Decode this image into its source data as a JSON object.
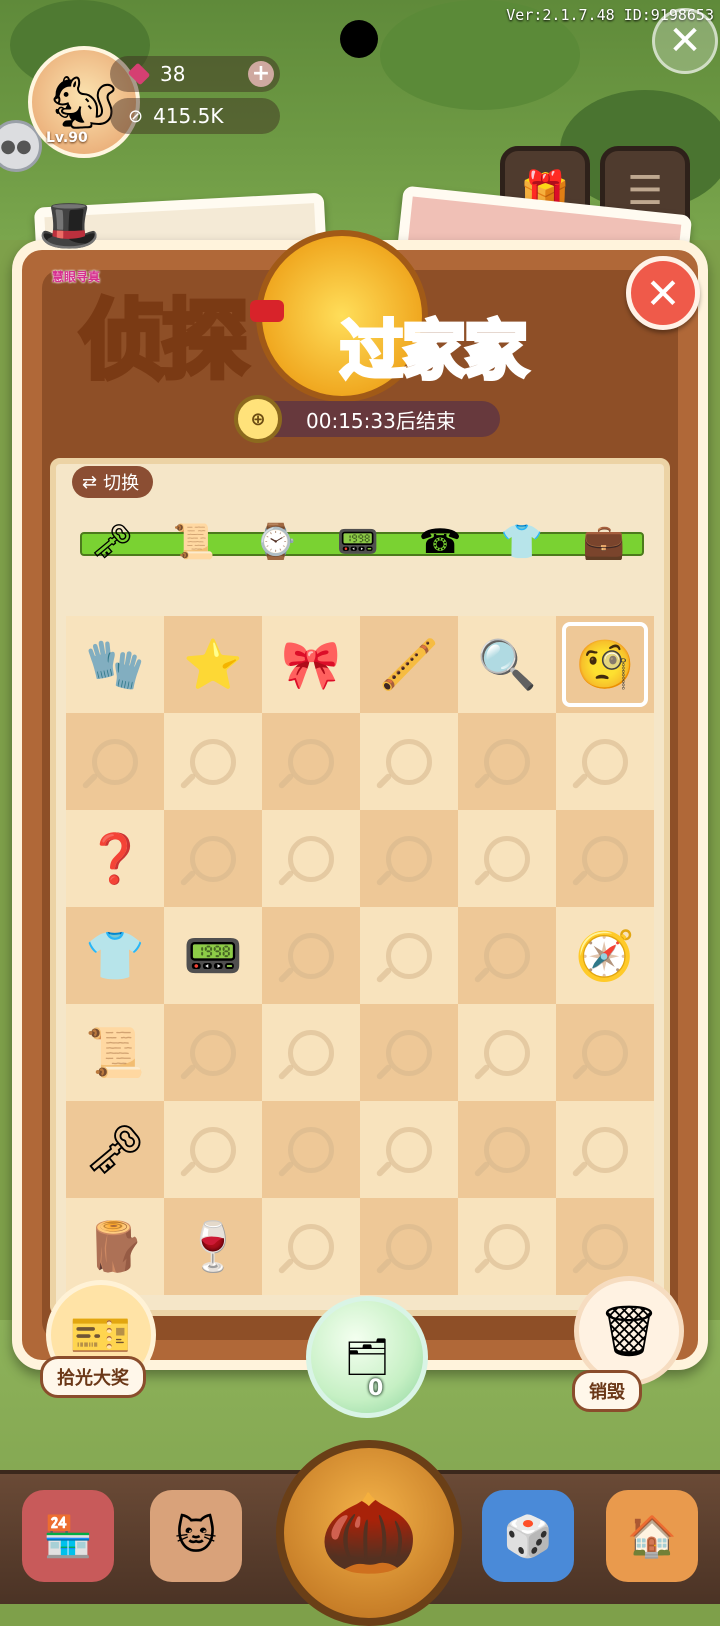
{
  "hud": {
    "version": "Ver:2.1.7.48 ID:9198653",
    "level": "Lv.90",
    "gems": "38",
    "seeds": "415.5K"
  },
  "event": {
    "badge_label": "慧眼寻真",
    "title_main": "侦探",
    "title_sub": "过家家",
    "timer": "00:15:33后结束",
    "switch_label": "切换"
  },
  "merge_chain": [
    {
      "icon": "key-icon"
    },
    {
      "icon": "torn-paper-icon"
    },
    {
      "icon": "pocket-watch-icon"
    },
    {
      "icon": "phone-device-icon"
    },
    {
      "icon": "telephone-icon"
    },
    {
      "icon": "shirt-icon"
    },
    {
      "icon": "briefcase-icon"
    }
  ],
  "grid": [
    [
      "gloves-icon",
      "badge-star-icon",
      "bowtie-icon",
      "pipe-icon",
      "magnifier-item-icon",
      "monocle-icon"
    ],
    [
      "",
      "",
      "",
      "",
      "",
      ""
    ],
    [
      "mystery-box-icon",
      "",
      "",
      "",
      "",
      ""
    ],
    [
      "shirt-icon",
      "phone-device-icon",
      "",
      "",
      "",
      "compass-watch-icon"
    ],
    [
      "torn-paper-icon",
      "",
      "",
      "",
      "",
      ""
    ],
    [
      "key-icon",
      "",
      "",
      "",
      "",
      ""
    ],
    [
      "wood-planks-icon",
      "wine-glass-icon",
      "",
      "",
      "",
      ""
    ]
  ],
  "bottom": {
    "left_button_label": "拾光大奖",
    "bubble_count": "0",
    "right_button_label": "销毁"
  },
  "colors": {
    "panel": "#b06838",
    "grid_light": "#f8e3bd",
    "grid_dark": "#eec897",
    "title_yellow": "#ffe24a",
    "title_red": "#ef3f3a",
    "progress_green": "#7ad232"
  }
}
